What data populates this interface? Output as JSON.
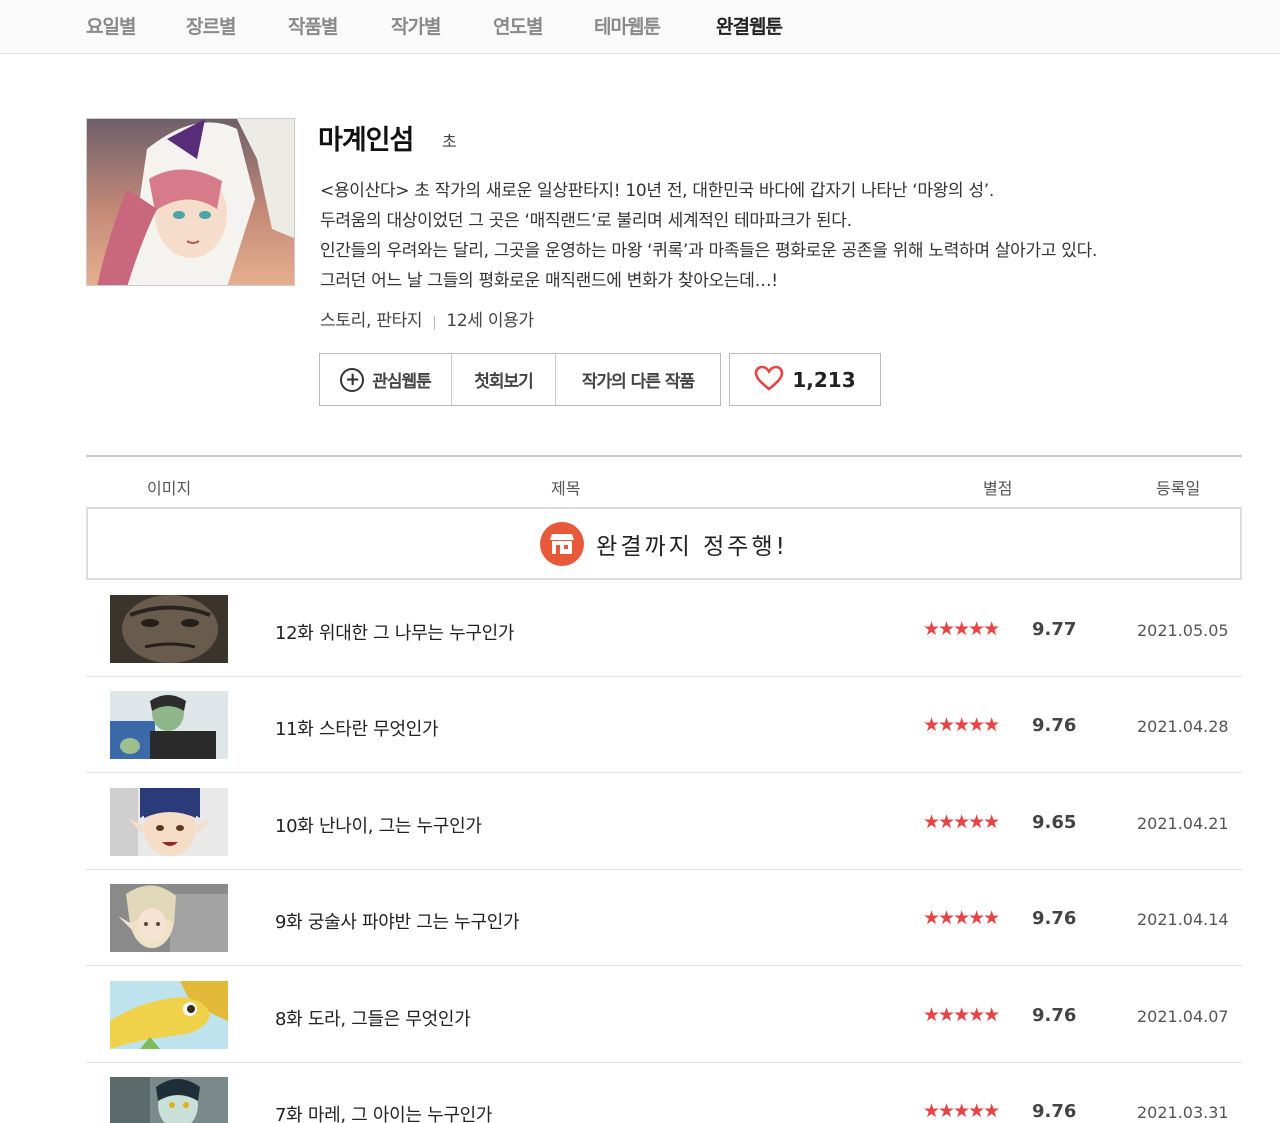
{
  "nav": {
    "tabs": [
      {
        "label": "요일별"
      },
      {
        "label": "장르별"
      },
      {
        "label": "작품별"
      },
      {
        "label": "작가별"
      },
      {
        "label": "연도별"
      },
      {
        "label": "테마웹툰"
      },
      {
        "label": "완결웹툰"
      }
    ],
    "active_tab": "완결웹툰"
  },
  "webtoon": {
    "title": "마계인섬",
    "author": "초",
    "synopsis": [
      "<용이산다> 초 작가의 새로운 일상판타지! 10년 전, 대한민국 바다에 갑자기 나타난 ‘마왕의 성’.",
      "두려움의 대상이었던 그 곳은 ‘매직랜드’로 불리며 세계적인 테마파크가 된다.",
      "인간들의 우려와는 달리, 그곳을 운영하는 마왕 ‘퀴록’과 마족들은 평화로운 공존을 위해 노력하며 살아가고 있다.",
      "그러던 어느 날 그들의 평화로운 매직랜드에 변화가 찾아오는데…!"
    ],
    "genre": "스토리, 판타지",
    "age_rating": "12세 이용가"
  },
  "actions": {
    "favorite_label": "관심웹툰",
    "first_episode_label": "첫회보기",
    "other_works_label": "작가의 다른 작품",
    "like_count": "1,213"
  },
  "table": {
    "headers": {
      "image": "이미지",
      "title": "제목",
      "rating": "별점",
      "date": "등록일"
    },
    "banner_text": "완결까지 정주행!",
    "stars": "★★★★★",
    "episodes": [
      {
        "title": "12화 위대한 그 나무는 누구인가",
        "rating": "9.77",
        "date": "2021.05.05"
      },
      {
        "title": "11화 스타란 무엇인가",
        "rating": "9.76",
        "date": "2021.04.28"
      },
      {
        "title": "10화 난나이, 그는 누구인가",
        "rating": "9.65",
        "date": "2021.04.21"
      },
      {
        "title": "9화 궁술사 파야반 그는 누구인가",
        "rating": "9.76",
        "date": "2021.04.14"
      },
      {
        "title": "8화 도라, 그들은 무엇인가",
        "rating": "9.76",
        "date": "2021.04.07"
      },
      {
        "title": "7화 마레, 그 아이는 누구인가",
        "rating": "9.76",
        "date": "2021.03.31"
      }
    ]
  },
  "colors": {
    "star": "#e64545",
    "banner_icon": "#e8593a",
    "heart": "#e64545"
  },
  "icons": {
    "favorite": "plus-circle-icon",
    "like": "heart-icon",
    "banner": "store-icon"
  }
}
